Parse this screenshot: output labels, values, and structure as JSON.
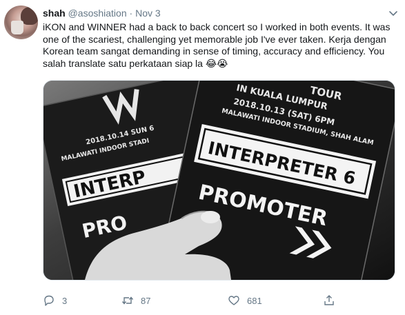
{
  "user": {
    "display_name": "shah",
    "handle": "@asoshiation",
    "separator": "·",
    "timestamp": "Nov 3"
  },
  "tweet": {
    "text": "iKON and WINNER had a back to back concert so I worked in both events. It was one of the scariest, challenging yet memorable job I've ever taken. Kerja dengan Korean team sangat demanding in sense of timing, accuracy and efficiency. You salah translate satu perkataan siap la",
    "emojis": "😂😭"
  },
  "media": {
    "back_card": {
      "date_line": "2018.10.14 SUN 6",
      "venue_line": "MALAWATI INDOOR STADI",
      "role": "INTERP",
      "type": "PRO"
    },
    "front_card": {
      "tour_line": "TOUR",
      "city_line": "IN KUALA LUMPUR",
      "date_line": "2018.10.13 (SAT) 6PM",
      "venue_line": "MALAWATI INDOOR STADIUM, SHAH ALAM",
      "role": "INTERPRETER 6",
      "type": "PROMOTER"
    }
  },
  "actions": {
    "replies": "3",
    "retweets": "87",
    "likes": "681"
  },
  "colors": {
    "text": "#14171a",
    "secondary": "#657786",
    "border": "#e1e8ed"
  },
  "icons": {
    "menu": "chevron-down-icon",
    "reply": "reply-icon",
    "retweet": "retweet-icon",
    "like": "heart-icon",
    "share": "share-icon"
  }
}
